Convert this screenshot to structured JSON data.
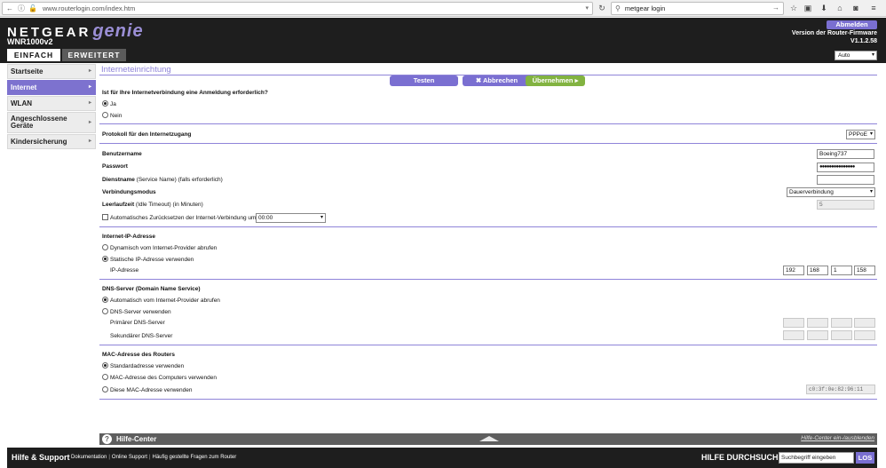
{
  "browser": {
    "url": "www.routerlogin.com/index.htm",
    "search_text": "metgear login"
  },
  "header": {
    "brand": "NETGEAR",
    "brand_genie": "genie",
    "model": "WNR1000v2",
    "logout_label": "Abmelden",
    "firmware_label": "Version der Router-Firmware",
    "firmware_version": "V1.1.2.58",
    "tabs": [
      {
        "label": "EINFACH",
        "active": true
      },
      {
        "label": "ERWEITERT",
        "active": false
      }
    ],
    "language_value": "Auto"
  },
  "sidebar": {
    "items": [
      {
        "label": "Startseite",
        "active": false
      },
      {
        "label": "Internet",
        "active": true
      },
      {
        "label": "WLAN",
        "active": false
      },
      {
        "label": "Angeschlossene Geräte",
        "active": false
      },
      {
        "label": "Kindersicherung",
        "active": false
      }
    ]
  },
  "main": {
    "title": "Interneteinrichtung",
    "buttons": {
      "test": "Testen",
      "cancel": "Abbrechen",
      "apply": "Übernehmen"
    },
    "login_question": "Ist für Ihre Internetverbindung eine Anmeldung erforderlich?",
    "login_options": [
      "Ja",
      "Nein"
    ],
    "login_selected": "Ja",
    "protocol_label": "Protokoll für den Internetzugang",
    "protocol_value": "PPPoE",
    "username_label": "Benutzername",
    "username_value": "Boeing737",
    "password_label": "Passwort",
    "password_value": "●●●●●●●●●●●●●●●",
    "service_label_bold": "Dienstname",
    "service_label_rest": " (Service Name) (falls erforderlich)",
    "service_value": "",
    "mode_label": "Verbindungsmodus",
    "mode_value": "Dauerverbindung",
    "idle_label_bold": "Leerlaufzeit",
    "idle_label_rest": " (Idle Timeout) (in Minuten)",
    "idle_value": "5",
    "auto_reset_label": "Automatisches Zurücksetzen der Internet-Verbindung um",
    "auto_reset_time": "00:00",
    "ip_section": "Internet-IP-Adresse",
    "ip_options": [
      "Dynamisch vom Internet-Provider abrufen",
      "Statische IP-Adresse verwenden"
    ],
    "ip_selected": "Statische IP-Adresse verwenden",
    "ip_address_label": "IP-Adresse",
    "ip_octets": [
      "192",
      "168",
      "1",
      "158"
    ],
    "dns_section": "DNS-Server (Domain Name Service)",
    "dns_options": [
      "Automatisch vom Internet-Provider abrufen",
      "DNS-Server verwenden"
    ],
    "dns_selected": "Automatisch vom Internet-Provider abrufen",
    "dns_primary_label": "Primärer DNS-Server",
    "dns_secondary_label": "Sekundärer DNS-Server",
    "mac_section": "MAC-Adresse des Routers",
    "mac_options": [
      "Standardadresse verwenden",
      "MAC-Adresse des Computers verwenden",
      "Diese MAC-Adresse verwenden"
    ],
    "mac_selected": "Standardadresse verwenden",
    "mac_value": "c0:3f:0e:82:96:11"
  },
  "helpbar": {
    "title": "Hilfe-Center",
    "show_label": "Hilfe-Center ein-/ausblenden"
  },
  "footer": {
    "help_title": "Hilfe & Support",
    "links": [
      "Dokumentation",
      "Online Support",
      "Häufig gestellte Fragen zum Router"
    ],
    "search_title": "HILFE DURCHSUCHEN",
    "search_value": "Suchbegriff eingeben",
    "search_button": "LOS"
  },
  "colors": {
    "accent": "#7a6fd1",
    "apply_green": "#82b341",
    "header_bg": "#1e1e1e"
  }
}
